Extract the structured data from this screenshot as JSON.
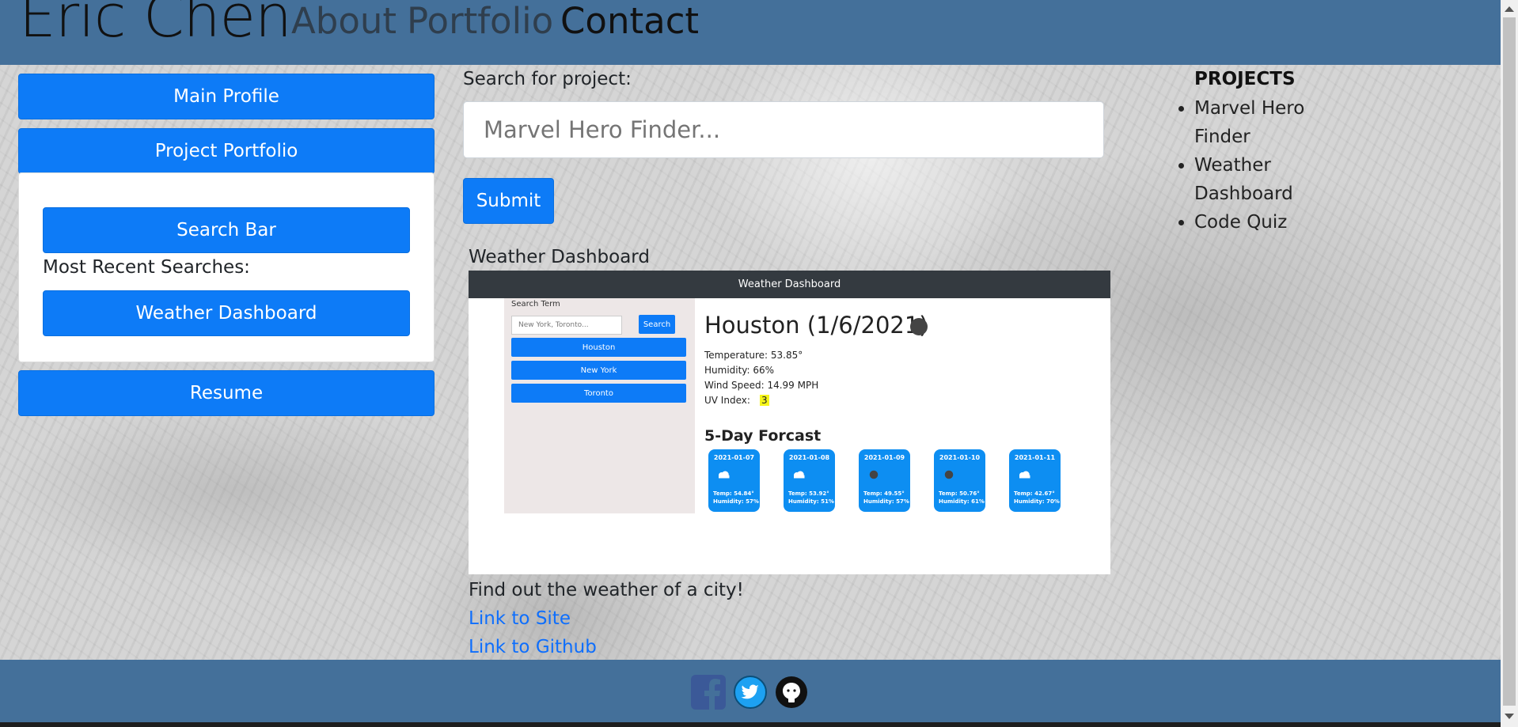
{
  "navbar": {
    "brand": "Eric Chen",
    "links": [
      "About",
      "Portfolio",
      "Contact"
    ]
  },
  "sidebar": {
    "main_profile": "Main Profile",
    "project_portfolio": "Project Portfolio",
    "search_bar": "Search Bar",
    "recent_label": "Most Recent Searches:",
    "recent_items": [
      "Weather Dashboard"
    ],
    "resume": "Resume"
  },
  "search": {
    "label": "Search for project:",
    "placeholder": "Marvel Hero Finder...",
    "submit": "Submit"
  },
  "project": {
    "title": "Weather Dashboard",
    "description": "Find out the weather of a city!",
    "site_link": "Link to Site",
    "github_link": "Link to Github"
  },
  "preview": {
    "header": "Weather Dashboard",
    "search_term_label": "Search Term",
    "search_placeholder": "New York, Toronto...",
    "search_button": "Search",
    "cities": [
      "Houston",
      "New York",
      "Toronto"
    ],
    "city_title": "Houston (1/6/2021)",
    "temperature": "Temperature: 53.85°",
    "humidity": "Humidity: 66%",
    "wind": "Wind Speed: 14.99 MPH",
    "uv_label": "UV Index:",
    "uv_value": "3",
    "forecast_title": "5-Day Forcast",
    "forecast": [
      {
        "date": "2021-01-07",
        "temp": "Temp: 54.84°",
        "humidity": "Humidity: 57%",
        "icon": "cloud-icon"
      },
      {
        "date": "2021-01-08",
        "temp": "Temp: 53.92°",
        "humidity": "Humidity: 51%",
        "icon": "cloud-icon"
      },
      {
        "date": "2021-01-09",
        "temp": "Temp: 49.55°",
        "humidity": "Humidity: 57%",
        "icon": "dot-icon"
      },
      {
        "date": "2021-01-10",
        "temp": "Temp: 50.76°",
        "humidity": "Humidity: 61%",
        "icon": "dot-icon"
      },
      {
        "date": "2021-01-11",
        "temp": "Temp: 42.67°",
        "humidity": "Humidity: 70%",
        "icon": "cloud-icon"
      }
    ]
  },
  "projects_panel": {
    "title": "PROJECTS",
    "items": [
      "Marvel Hero Finder",
      "Weather Dashboard",
      "Code Quiz"
    ]
  },
  "footer": {
    "icons": [
      "facebook-icon",
      "twitter-icon",
      "github-icon"
    ]
  },
  "colors": {
    "navbar": "#44709a",
    "button": "#0d7bf7",
    "link": "#0d6efd"
  }
}
